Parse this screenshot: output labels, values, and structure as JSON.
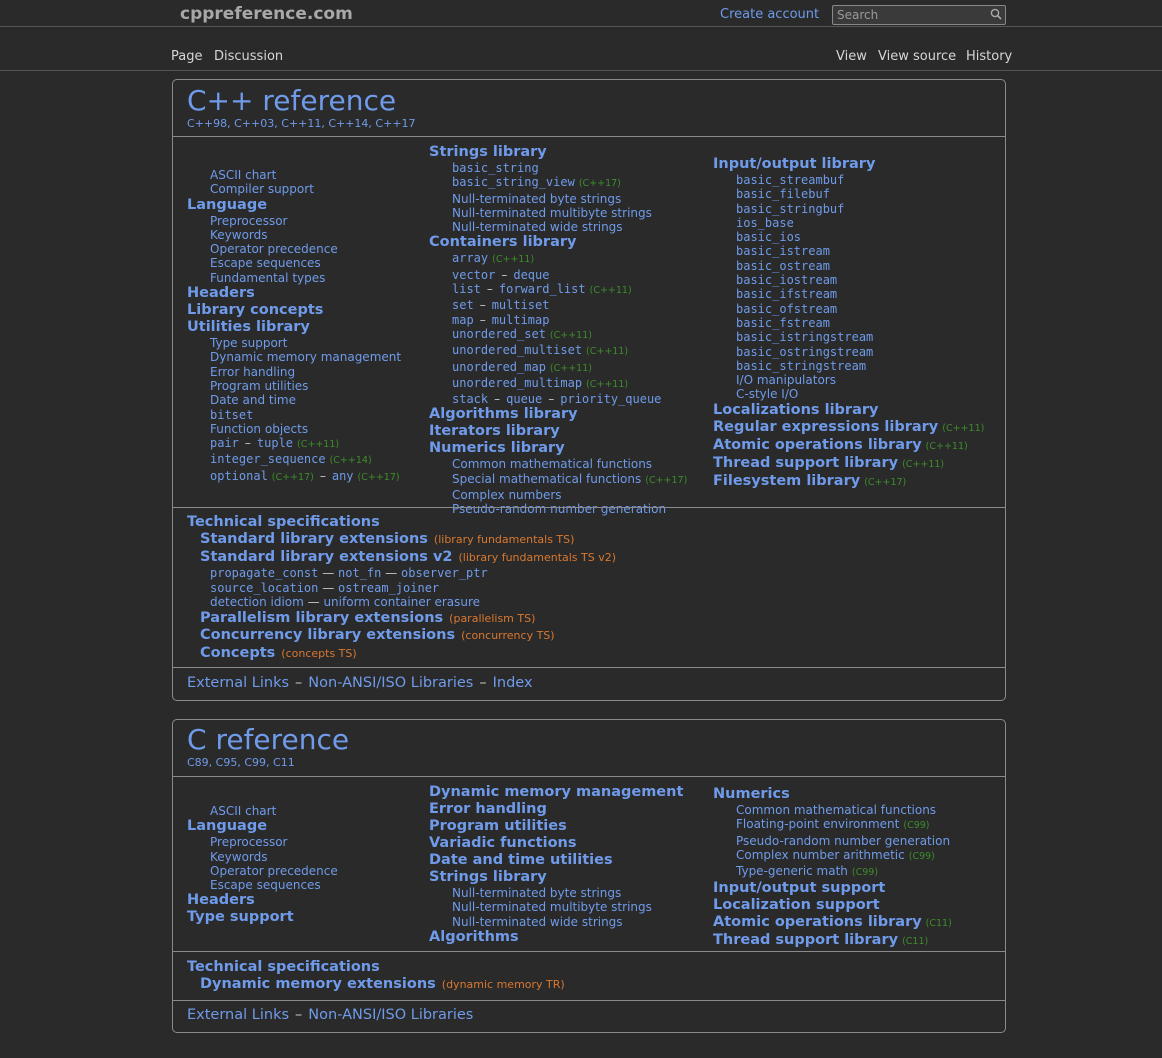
{
  "site": {
    "logo": "cppreference.com",
    "create_account": "Create account",
    "search_placeholder": "Search"
  },
  "tabs": {
    "page": "Page",
    "discussion": "Discussion",
    "view": "View",
    "view_source": "View source",
    "history": "History"
  },
  "cpp": {
    "title": "C++ reference",
    "versions": "C++98, C++03, C++11, C++14, C++17",
    "col1": {
      "ascii": "ASCII chart",
      "compiler": "Compiler support",
      "language": "Language",
      "preprocessor": "Preprocessor",
      "keywords": "Keywords",
      "opprec": "Operator precedence",
      "escape": "Escape sequences",
      "fundtypes": "Fundamental types",
      "headers": "Headers",
      "libconcepts": "Library concepts",
      "utilities": "Utilities library",
      "typesupport": "Type support",
      "dynmem": "Dynamic memory management",
      "errhandling": "Error handling",
      "progutil": "Program utilities",
      "datetime": "Date and time",
      "bitset": "bitset",
      "funcobj": "Function objects",
      "pair": "pair",
      "tuple": "tuple",
      "tuple_tag": "(C++11)",
      "intseq": "integer_sequence",
      "intseq_tag": "(C++14)",
      "optional": "optional",
      "optional_tag": "(C++17)",
      "any": "any",
      "any_tag": "(C++17)"
    },
    "col2": {
      "strings": "Strings library",
      "basic_string": "basic_string",
      "basic_string_view": "basic_string_view",
      "bsv_tag": "(C++17)",
      "ntbs": "Null-terminated byte strings",
      "ntmbs": "Null-terminated multibyte strings",
      "ntws": "Null-terminated wide strings",
      "containers": "Containers library",
      "array": "array",
      "array_tag": "(C++11)",
      "vector": "vector",
      "deque": "deque",
      "list": "list",
      "forward_list": "forward_list",
      "fl_tag": "(C++11)",
      "set": "set",
      "multiset": "multiset",
      "map": "map",
      "multimap": "multimap",
      "unordered_set": "unordered_set",
      "us_tag": "(C++11)",
      "unordered_multiset": "unordered_multiset",
      "ums_tag": "(C++11)",
      "unordered_map": "unordered_map",
      "um_tag": "(C++11)",
      "unordered_multimap": "unordered_multimap",
      "umm_tag": "(C++11)",
      "stack": "stack",
      "queue": "queue",
      "priority_queue": "priority_queue",
      "algorithms": "Algorithms library",
      "iterators": "Iterators library",
      "numerics": "Numerics library",
      "commonmath": "Common mathematical functions",
      "specialmath": "Special mathematical functions",
      "specialmath_tag": "(C++17)",
      "complex": "Complex numbers",
      "prng": "Pseudo-random number generation"
    },
    "col3": {
      "io": "Input/output library",
      "items": [
        "basic_streambuf",
        "basic_filebuf",
        "basic_stringbuf",
        "ios_base",
        "basic_ios",
        "basic_istream",
        "basic_ostream",
        "basic_iostream",
        "basic_ifstream",
        "basic_ofstream",
        "basic_fstream",
        "basic_istringstream",
        "basic_ostringstream",
        "basic_stringstream"
      ],
      "iomanip": "I/O manipulators",
      "cstyleio": "C-style I/O",
      "localizations": "Localizations library",
      "regex": "Regular expressions library",
      "regex_tag": "(C++11)",
      "atomic": "Atomic operations library",
      "atomic_tag": "(C++11)",
      "thread": "Thread support library",
      "thread_tag": "(C++11)",
      "filesystem": "Filesystem library",
      "filesystem_tag": "(C++17)"
    },
    "ts": {
      "title": "Technical specifications",
      "stdext": "Standard library extensions",
      "stdext_tag": "(library fundamentals TS)",
      "stdext2": "Standard library extensions v2",
      "stdext2_tag": "(library fundamentals TS v2)",
      "propagate_const": "propagate_const",
      "not_fn": "not_fn",
      "observer_ptr": "observer_ptr",
      "source_location": "source_location",
      "ostream_joiner": "ostream_joiner",
      "detection": "detection idiom",
      "erasure": "uniform container erasure",
      "parallelism": "Parallelism library extensions",
      "parallelism_tag": "(parallelism TS)",
      "concurrency": "Concurrency library extensions",
      "concurrency_tag": "(concurrency TS)",
      "concepts": "Concepts",
      "concepts_tag": "(concepts TS)"
    },
    "footer": {
      "external": "External Links",
      "nonansi": "Non-ANSI/ISO Libraries",
      "index": "Index"
    }
  },
  "c": {
    "title": "C reference",
    "versions": "C89, C95, C99, C11",
    "col1": {
      "ascii": "ASCII chart",
      "language": "Language",
      "preprocessor": "Preprocessor",
      "keywords": "Keywords",
      "opprec": "Operator precedence",
      "escape": "Escape sequences",
      "headers": "Headers",
      "typesupport": "Type support"
    },
    "col2": {
      "dynmem": "Dynamic memory management",
      "errhandling": "Error handling",
      "progutil": "Program utilities",
      "variadic": "Variadic functions",
      "datetime": "Date and time utilities",
      "strings": "Strings library",
      "ntbs": "Null-terminated byte strings",
      "ntmbs": "Null-terminated multibyte strings",
      "ntws": "Null-terminated wide strings",
      "algorithms": "Algorithms"
    },
    "col3": {
      "numerics": "Numerics",
      "commonmath": "Common mathematical functions",
      "fenv": "Floating-point environment",
      "fenv_tag": "(C99)",
      "prng": "Pseudo-random number generation",
      "complex": "Complex number arithmetic",
      "complex_tag": "(C99)",
      "tgmath": "Type-generic math",
      "tgmath_tag": "(C99)",
      "io": "Input/output support",
      "localization": "Localization support",
      "atomic": "Atomic operations library",
      "atomic_tag": "(C11)",
      "thread": "Thread support library",
      "thread_tag": "(C11)"
    },
    "ts": {
      "title": "Technical specifications",
      "dynmemext": "Dynamic memory extensions",
      "dynmemext_tag": "(dynamic memory TR)"
    },
    "footer": {
      "external": "External Links",
      "nonansi": "Non-ANSI/ISO Libraries"
    }
  }
}
